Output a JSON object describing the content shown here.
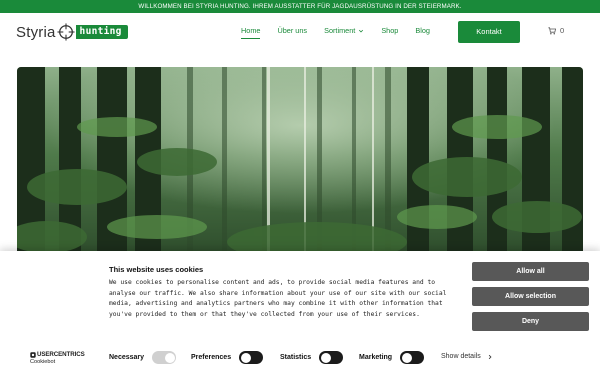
{
  "topbar": {
    "text": "WILLKOMMEN BEI STYRIA HUNTING. IHREM AUSSTATTER FÜR JAGDAUSRÜSTUNG IN DER STEIERMARK."
  },
  "logo": {
    "word": "Styria",
    "badge": "hunting"
  },
  "nav": {
    "items": [
      {
        "label": "Home",
        "active": true
      },
      {
        "label": "Über uns"
      },
      {
        "label": "Sortiment",
        "dropdown": true
      },
      {
        "label": "Shop"
      },
      {
        "label": "Blog"
      }
    ]
  },
  "header": {
    "contact_label": "Kontakt",
    "cart_count": "0"
  },
  "colors": {
    "brand_green": "#1a8a3a",
    "cookie_button": "#585858",
    "toggle_dark": "#1b1b1b"
  },
  "cookie": {
    "title": "This website uses cookies",
    "text": "We use cookies to personalise content and ads, to provide social media features and to analyse our traffic. We also share information about your use of our site with our social media, advertising and analytics partners who may combine it with other information that you've provided to them or that they've collected from your use of their services.",
    "allow_all": "Allow all",
    "allow_selection": "Allow selection",
    "deny": "Deny",
    "brand_main": "USERCENTRICS",
    "brand_sub": "Cookiebot",
    "toggles": [
      {
        "label": "Necessary",
        "on": true,
        "locked": true
      },
      {
        "label": "Preferences",
        "on": false
      },
      {
        "label": "Statistics",
        "on": false
      },
      {
        "label": "Marketing",
        "on": false
      }
    ],
    "show_details": "Show details"
  }
}
